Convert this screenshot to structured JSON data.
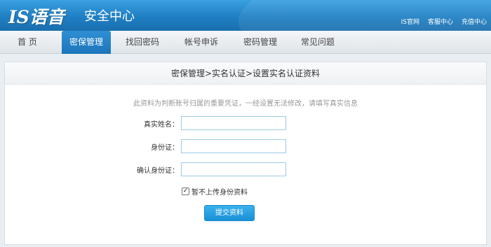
{
  "header": {
    "logo_text": "IS语音",
    "title": "安全中心",
    "links": [
      "IS官网",
      "客服中心",
      "充值中心"
    ]
  },
  "nav": {
    "items": [
      "首 页",
      "密保管理",
      "找回密码",
      "帐号申诉",
      "密码管理",
      "常见问题"
    ],
    "active_index": 1
  },
  "main": {
    "breadcrumb": "密保管理>实名认证>设置实名认证资料",
    "notice": "此资料为判断账号归属的重要凭证，一经设置无法修改，请填写真实信息",
    "fields": [
      {
        "label": "真实姓名：",
        "value": ""
      },
      {
        "label": "身份证：",
        "value": ""
      },
      {
        "label": "确认身份证：",
        "value": ""
      }
    ],
    "checkbox": {
      "label": "暂不上传身份资料",
      "checked": true
    },
    "submit_label": "提交资料"
  },
  "colors": {
    "header_blue": "#1f7fc4",
    "accent_blue": "#1b91d6",
    "input_border": "#9ccbe6"
  }
}
